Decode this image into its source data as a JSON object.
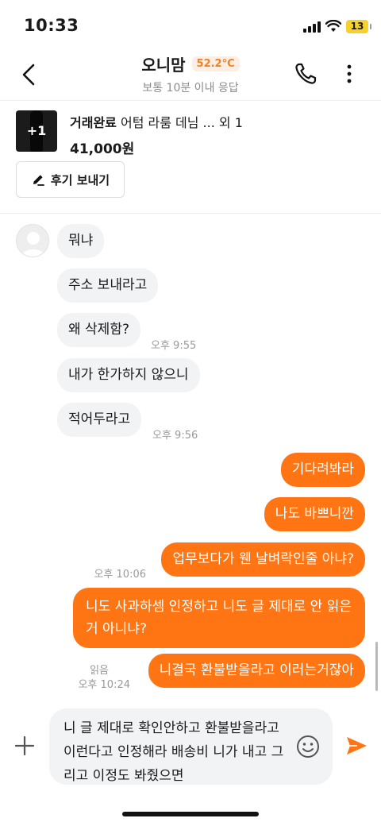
{
  "status_bar": {
    "time": "10:33",
    "battery": "13"
  },
  "header": {
    "name": "오니맘",
    "temperature": "52.2°C",
    "response_time": "보통 10분 이내 응답",
    "accent_color": "#f08223"
  },
  "product": {
    "thumb_count": "+1",
    "status": "거래완료",
    "title": "어텀 라룸 데님 ... 외 1",
    "price": "41,000원",
    "review_button": "후기 보내기"
  },
  "messages": {
    "incoming": [
      {
        "text": "뭐냐",
        "time": ""
      },
      {
        "text": "주소 보내라고",
        "time": ""
      },
      {
        "text": "왜 삭제함?",
        "time": "오후 9:55"
      },
      {
        "text": "내가 한가하지 않으니",
        "time": ""
      },
      {
        "text": "적어두라고",
        "time": "오후 9:56"
      }
    ],
    "outgoing": [
      {
        "text": "기다려봐라",
        "time": ""
      },
      {
        "text": "나도 바쁘니깐",
        "time": ""
      },
      {
        "text": "업무보다가 웬 날벼락인줄 아냐?",
        "time": "오후 10:06"
      },
      {
        "text": "니도 사과하셈 인정하고 니도 글 제대로 안 읽은거 아니냐?",
        "time": ""
      },
      {
        "text": "니결국 환불받을라고 이러는거잖아",
        "time": "오후 10:24",
        "read": "읽음"
      }
    ],
    "outgoing_color": "#ff7413"
  },
  "input": {
    "value": "니 글 제대로 확인안하고 환불받을라고 이런다고 인정해라 배송비 니가 내고 그리고 이정도 봐줬으면"
  }
}
